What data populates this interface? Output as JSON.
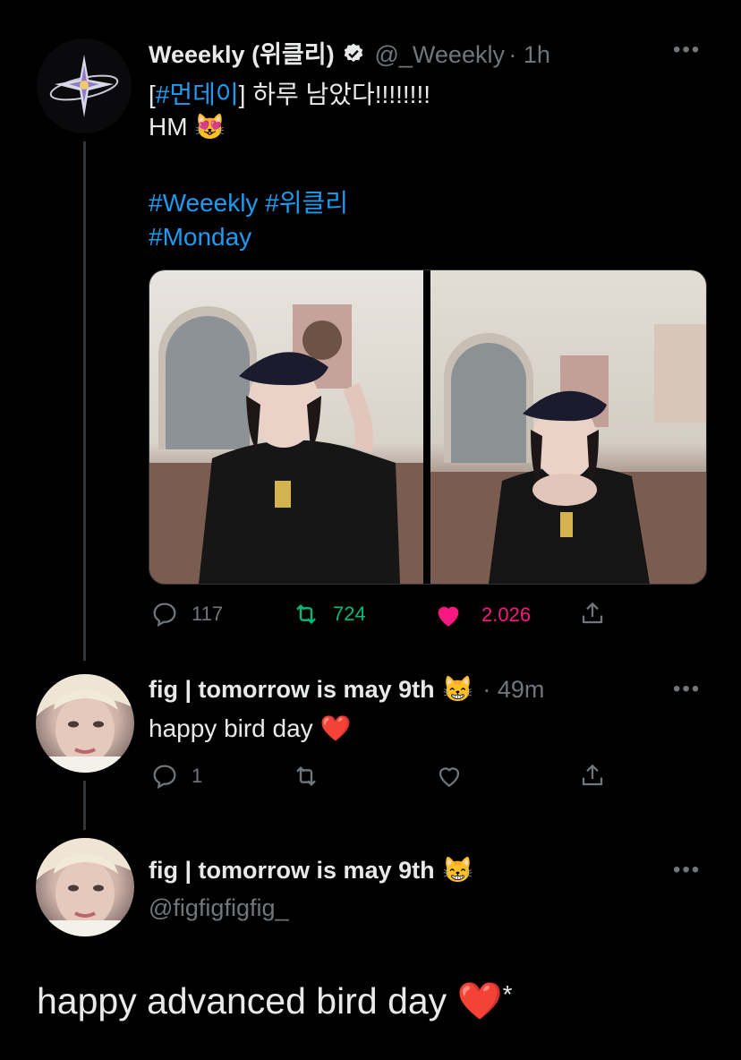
{
  "tweet1": {
    "display_name": "Weeekly (위클리)",
    "handle": "@_Weeekly",
    "time": "· 1h",
    "line1_bracket_open": "[",
    "line1_tag": "#먼데이",
    "line1_rest": "] 하루 남았다!!!!!!!!",
    "line2": "HM",
    "line2_emoji": "😻",
    "hashtag1": "#Weeekly",
    "hashtag2": "#위클리",
    "hashtag3": "#Monday",
    "replies": "117",
    "retweets": "724",
    "likes": "2.026"
  },
  "tweet2": {
    "display_name": "fig | tomorrow is may 9th",
    "name_emoji": "😸",
    "time": "· 49m",
    "text": "happy bird day",
    "text_emoji": "❤️",
    "replies": "1"
  },
  "tweet3": {
    "display_name": "fig | tomorrow is may 9th",
    "name_emoji": "😸",
    "handle": "@figfigfigfig_",
    "text": "happy advanced bird day",
    "text_emoji": "❤️",
    "text_suffix": "*"
  },
  "more_label": "•••",
  "colors": {
    "retweet": "#00ba7c",
    "like": "#f91880",
    "link": "#1d9bf0",
    "muted": "#71767b"
  }
}
